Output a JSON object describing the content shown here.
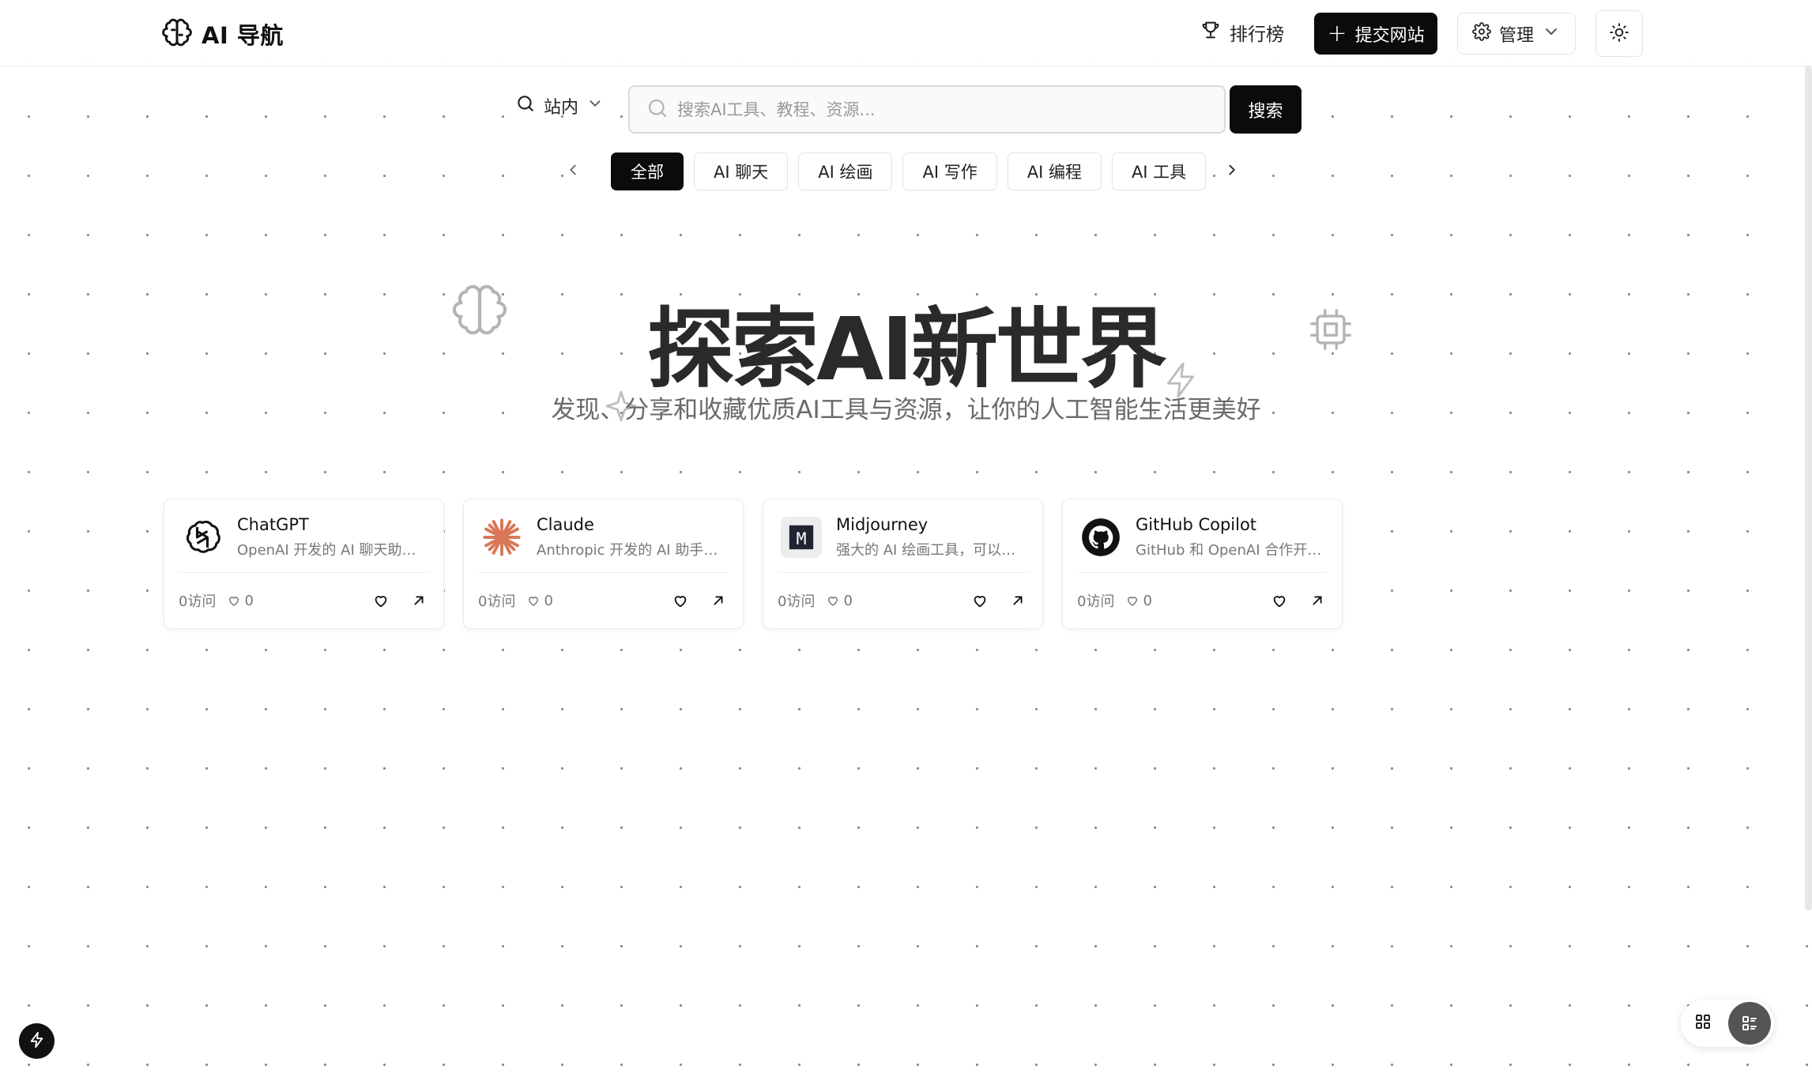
{
  "header": {
    "logo_text": "AI 导航",
    "ranking_label": "排行榜",
    "submit_label": "提交网站",
    "manage_label": "管理"
  },
  "search": {
    "scope_label": "站内",
    "placeholder": "搜索AI工具、教程、资源...",
    "button_label": "搜索"
  },
  "categories": [
    {
      "label": "全部",
      "active": true
    },
    {
      "label": "AI 聊天",
      "active": false
    },
    {
      "label": "AI 绘画",
      "active": false
    },
    {
      "label": "AI 写作",
      "active": false
    },
    {
      "label": "AI 编程",
      "active": false
    },
    {
      "label": "AI 工具",
      "active": false
    }
  ],
  "hero": {
    "title": "探索AI新世界",
    "subtitle": "发现、分享和收藏优质AI工具与资源，让你的人工智能生活更美好"
  },
  "cards": [
    {
      "name": "ChatGPT",
      "description": "OpenAI 开发的 AI 聊天助手...",
      "visits": "0访问",
      "likes": "0",
      "icon": "openai-icon"
    },
    {
      "name": "Claude",
      "description": "Anthropic 开发的 AI 助手，...",
      "visits": "0访问",
      "likes": "0",
      "icon": "claude-icon"
    },
    {
      "name": "Midjourney",
      "description": "强大的 AI 绘画工具，可以通...",
      "visits": "0访问",
      "likes": "0",
      "icon": "midjourney-icon"
    },
    {
      "name": "GitHub Copilot",
      "description": "GitHub 和 OpenAI 合作开发...",
      "visits": "0访问",
      "likes": "0",
      "icon": "github-icon"
    }
  ],
  "colors": {
    "primary": "#0b0b0b",
    "claude_accent": "#d97757",
    "muted_text": "#777777"
  }
}
